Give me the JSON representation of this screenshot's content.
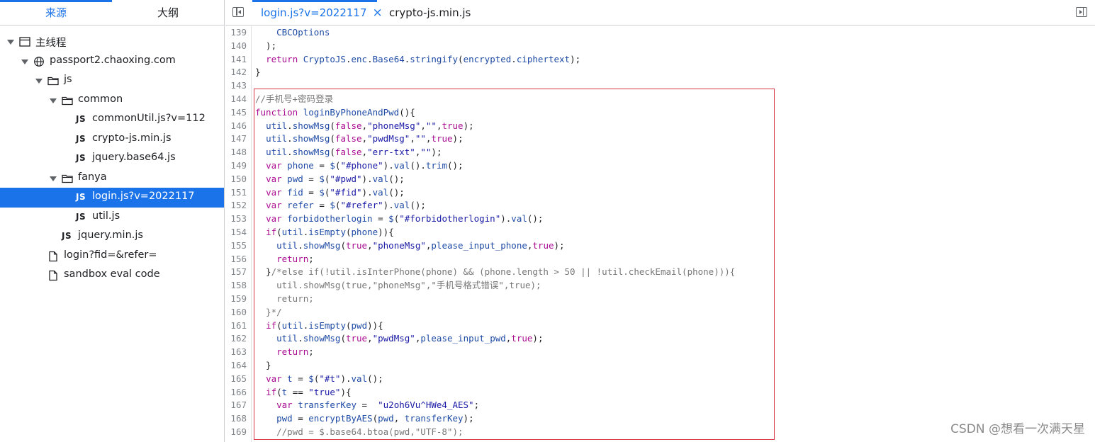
{
  "left_tabs": [
    {
      "label": "来源",
      "active": true
    },
    {
      "label": "大纲",
      "active": false
    }
  ],
  "tree": [
    {
      "label": "主线程",
      "depth": 0,
      "expanded": true,
      "icon": "window-icon"
    },
    {
      "label": "passport2.chaoxing.com",
      "depth": 1,
      "expanded": true,
      "icon": "globe-icon"
    },
    {
      "label": "js",
      "depth": 2,
      "expanded": true,
      "icon": "folder-icon"
    },
    {
      "label": "common",
      "depth": 3,
      "expanded": true,
      "icon": "folder-icon"
    },
    {
      "label": "commonUtil.js?v=112",
      "depth": 4,
      "icon": "js-file-icon"
    },
    {
      "label": "crypto-js.min.js",
      "depth": 4,
      "icon": "js-file-icon"
    },
    {
      "label": "jquery.base64.js",
      "depth": 4,
      "icon": "js-file-icon"
    },
    {
      "label": "fanya",
      "depth": 3,
      "expanded": true,
      "icon": "folder-icon"
    },
    {
      "label": "login.js?v=2022117",
      "depth": 4,
      "icon": "js-file-icon",
      "selected": true
    },
    {
      "label": "util.js",
      "depth": 4,
      "icon": "js-file-icon"
    },
    {
      "label": "jquery.min.js",
      "depth": 3,
      "icon": "js-file-icon"
    },
    {
      "label": "login?fid=&refer=",
      "depth": 2,
      "icon": "document-icon"
    },
    {
      "label": "sandbox eval code",
      "depth": 2,
      "icon": "document-icon"
    }
  ],
  "editor_tabs": [
    {
      "label": "login.js?v=2022117",
      "active": true,
      "closable": true
    },
    {
      "label": "crypto-js.min.js",
      "active": false
    }
  ],
  "icons": {
    "close": "×",
    "js": "JS"
  },
  "code_lines": [
    {
      "n": 139,
      "tokens": [
        [
          "d",
          "    "
        ],
        [
          "v",
          "CBCOptions"
        ]
      ]
    },
    {
      "n": 140,
      "tokens": [
        [
          "d",
          "  );"
        ]
      ]
    },
    {
      "n": 141,
      "tokens": [
        [
          "d",
          "  "
        ],
        [
          "k",
          "return"
        ],
        [
          "d",
          " "
        ],
        [
          "v",
          "CryptoJS"
        ],
        [
          "d",
          "."
        ],
        [
          "v",
          "enc"
        ],
        [
          "d",
          "."
        ],
        [
          "v",
          "Base64"
        ],
        [
          "d",
          "."
        ],
        [
          "v",
          "stringify"
        ],
        [
          "d",
          "("
        ],
        [
          "v",
          "encrypted"
        ],
        [
          "d",
          "."
        ],
        [
          "v",
          "ciphertext"
        ],
        [
          "d",
          ");"
        ]
      ]
    },
    {
      "n": 142,
      "tokens": [
        [
          "d",
          "}"
        ]
      ]
    },
    {
      "n": 143,
      "tokens": [
        [
          "d",
          ""
        ]
      ]
    },
    {
      "n": 144,
      "tokens": [
        [
          "c",
          "//手机号+密码登录"
        ]
      ]
    },
    {
      "n": 145,
      "tokens": [
        [
          "k",
          "function"
        ],
        [
          "d",
          " "
        ],
        [
          "v",
          "loginByPhoneAndPwd"
        ],
        [
          "d",
          "(){"
        ]
      ]
    },
    {
      "n": 146,
      "tokens": [
        [
          "d",
          "  "
        ],
        [
          "v",
          "util"
        ],
        [
          "d",
          "."
        ],
        [
          "v",
          "showMsg"
        ],
        [
          "d",
          "("
        ],
        [
          "k",
          "false"
        ],
        [
          "d",
          ","
        ],
        [
          "s",
          "\"phoneMsg\""
        ],
        [
          "d",
          ","
        ],
        [
          "s",
          "\"\""
        ],
        [
          "d",
          ","
        ],
        [
          "k",
          "true"
        ],
        [
          "d",
          ");"
        ]
      ]
    },
    {
      "n": 147,
      "tokens": [
        [
          "d",
          "  "
        ],
        [
          "v",
          "util"
        ],
        [
          "d",
          "."
        ],
        [
          "v",
          "showMsg"
        ],
        [
          "d",
          "("
        ],
        [
          "k",
          "false"
        ],
        [
          "d",
          ","
        ],
        [
          "s",
          "\"pwdMsg\""
        ],
        [
          "d",
          ","
        ],
        [
          "s",
          "\"\""
        ],
        [
          "d",
          ","
        ],
        [
          "k",
          "true"
        ],
        [
          "d",
          ");"
        ]
      ]
    },
    {
      "n": 148,
      "tokens": [
        [
          "d",
          "  "
        ],
        [
          "v",
          "util"
        ],
        [
          "d",
          "."
        ],
        [
          "v",
          "showMsg"
        ],
        [
          "d",
          "("
        ],
        [
          "k",
          "false"
        ],
        [
          "d",
          ","
        ],
        [
          "s",
          "\"err-txt\""
        ],
        [
          "d",
          ","
        ],
        [
          "s",
          "\"\""
        ],
        [
          "d",
          ");"
        ]
      ]
    },
    {
      "n": 149,
      "tokens": [
        [
          "d",
          "  "
        ],
        [
          "k",
          "var"
        ],
        [
          "d",
          " "
        ],
        [
          "v",
          "phone"
        ],
        [
          "d",
          " = "
        ],
        [
          "v",
          "$"
        ],
        [
          "d",
          "("
        ],
        [
          "s",
          "\"#phone\""
        ],
        [
          "d",
          ")."
        ],
        [
          "v",
          "val"
        ],
        [
          "d",
          "()."
        ],
        [
          "v",
          "trim"
        ],
        [
          "d",
          "();"
        ]
      ]
    },
    {
      "n": 150,
      "tokens": [
        [
          "d",
          "  "
        ],
        [
          "k",
          "var"
        ],
        [
          "d",
          " "
        ],
        [
          "v",
          "pwd"
        ],
        [
          "d",
          " = "
        ],
        [
          "v",
          "$"
        ],
        [
          "d",
          "("
        ],
        [
          "s",
          "\"#pwd\""
        ],
        [
          "d",
          ")."
        ],
        [
          "v",
          "val"
        ],
        [
          "d",
          "();"
        ]
      ]
    },
    {
      "n": 151,
      "tokens": [
        [
          "d",
          "  "
        ],
        [
          "k",
          "var"
        ],
        [
          "d",
          " "
        ],
        [
          "v",
          "fid"
        ],
        [
          "d",
          " = "
        ],
        [
          "v",
          "$"
        ],
        [
          "d",
          "("
        ],
        [
          "s",
          "\"#fid\""
        ],
        [
          "d",
          ")."
        ],
        [
          "v",
          "val"
        ],
        [
          "d",
          "();"
        ]
      ]
    },
    {
      "n": 152,
      "tokens": [
        [
          "d",
          "  "
        ],
        [
          "k",
          "var"
        ],
        [
          "d",
          " "
        ],
        [
          "v",
          "refer"
        ],
        [
          "d",
          " = "
        ],
        [
          "v",
          "$"
        ],
        [
          "d",
          "("
        ],
        [
          "s",
          "\"#refer\""
        ],
        [
          "d",
          ")."
        ],
        [
          "v",
          "val"
        ],
        [
          "d",
          "();"
        ]
      ]
    },
    {
      "n": 153,
      "tokens": [
        [
          "d",
          "  "
        ],
        [
          "k",
          "var"
        ],
        [
          "d",
          " "
        ],
        [
          "v",
          "forbidotherlogin"
        ],
        [
          "d",
          " = "
        ],
        [
          "v",
          "$"
        ],
        [
          "d",
          "("
        ],
        [
          "s",
          "\"#forbidotherlogin\""
        ],
        [
          "d",
          ")."
        ],
        [
          "v",
          "val"
        ],
        [
          "d",
          "();"
        ]
      ]
    },
    {
      "n": 154,
      "tokens": [
        [
          "d",
          "  "
        ],
        [
          "k",
          "if"
        ],
        [
          "d",
          "("
        ],
        [
          "v",
          "util"
        ],
        [
          "d",
          "."
        ],
        [
          "v",
          "isEmpty"
        ],
        [
          "d",
          "("
        ],
        [
          "v",
          "phone"
        ],
        [
          "d",
          ")){"
        ]
      ]
    },
    {
      "n": 155,
      "tokens": [
        [
          "d",
          "    "
        ],
        [
          "v",
          "util"
        ],
        [
          "d",
          "."
        ],
        [
          "v",
          "showMsg"
        ],
        [
          "d",
          "("
        ],
        [
          "k",
          "true"
        ],
        [
          "d",
          ","
        ],
        [
          "s",
          "\"phoneMsg\""
        ],
        [
          "d",
          ","
        ],
        [
          "v",
          "please_input_phone"
        ],
        [
          "d",
          ","
        ],
        [
          "k",
          "true"
        ],
        [
          "d",
          ");"
        ]
      ]
    },
    {
      "n": 156,
      "tokens": [
        [
          "d",
          "    "
        ],
        [
          "k",
          "return"
        ],
        [
          "d",
          ";"
        ]
      ]
    },
    {
      "n": 157,
      "tokens": [
        [
          "d",
          "  }"
        ],
        [
          "c",
          "/*else if(!util.isInterPhone(phone) && (phone.length > 50 || !util.checkEmail(phone))){"
        ]
      ]
    },
    {
      "n": 158,
      "tokens": [
        [
          "c",
          "    util.showMsg(true,\"phoneMsg\",\"手机号格式错误\",true);"
        ]
      ]
    },
    {
      "n": 159,
      "tokens": [
        [
          "c",
          "    return;"
        ]
      ]
    },
    {
      "n": 160,
      "tokens": [
        [
          "c",
          "  }*/"
        ]
      ]
    },
    {
      "n": 161,
      "tokens": [
        [
          "d",
          "  "
        ],
        [
          "k",
          "if"
        ],
        [
          "d",
          "("
        ],
        [
          "v",
          "util"
        ],
        [
          "d",
          "."
        ],
        [
          "v",
          "isEmpty"
        ],
        [
          "d",
          "("
        ],
        [
          "v",
          "pwd"
        ],
        [
          "d",
          ")){"
        ]
      ]
    },
    {
      "n": 162,
      "tokens": [
        [
          "d",
          "    "
        ],
        [
          "v",
          "util"
        ],
        [
          "d",
          "."
        ],
        [
          "v",
          "showMsg"
        ],
        [
          "d",
          "("
        ],
        [
          "k",
          "true"
        ],
        [
          "d",
          ","
        ],
        [
          "s",
          "\"pwdMsg\""
        ],
        [
          "d",
          ","
        ],
        [
          "v",
          "please_input_pwd"
        ],
        [
          "d",
          ","
        ],
        [
          "k",
          "true"
        ],
        [
          "d",
          ");"
        ]
      ]
    },
    {
      "n": 163,
      "tokens": [
        [
          "d",
          "    "
        ],
        [
          "k",
          "return"
        ],
        [
          "d",
          ";"
        ]
      ]
    },
    {
      "n": 164,
      "tokens": [
        [
          "d",
          "  }"
        ]
      ]
    },
    {
      "n": 165,
      "tokens": [
        [
          "d",
          "  "
        ],
        [
          "k",
          "var"
        ],
        [
          "d",
          " "
        ],
        [
          "v",
          "t"
        ],
        [
          "d",
          " = "
        ],
        [
          "v",
          "$"
        ],
        [
          "d",
          "("
        ],
        [
          "s",
          "\"#t\""
        ],
        [
          "d",
          ")."
        ],
        [
          "v",
          "val"
        ],
        [
          "d",
          "();"
        ]
      ]
    },
    {
      "n": 166,
      "tokens": [
        [
          "d",
          "  "
        ],
        [
          "k",
          "if"
        ],
        [
          "d",
          "("
        ],
        [
          "v",
          "t"
        ],
        [
          "d",
          " == "
        ],
        [
          "s",
          "\"true\""
        ],
        [
          "d",
          "){"
        ]
      ]
    },
    {
      "n": 167,
      "tokens": [
        [
          "d",
          "    "
        ],
        [
          "k",
          "var"
        ],
        [
          "d",
          " "
        ],
        [
          "v",
          "transferKey"
        ],
        [
          "d",
          " =  "
        ],
        [
          "s",
          "\"u2oh6Vu^HWe4_AES\""
        ],
        [
          "d",
          ";"
        ]
      ]
    },
    {
      "n": 168,
      "tokens": [
        [
          "d",
          "    "
        ],
        [
          "v",
          "pwd"
        ],
        [
          "d",
          " = "
        ],
        [
          "v",
          "encryptByAES"
        ],
        [
          "d",
          "("
        ],
        [
          "v",
          "pwd"
        ],
        [
          "d",
          ", "
        ],
        [
          "v",
          "transferKey"
        ],
        [
          "d",
          ");"
        ]
      ]
    },
    {
      "n": 169,
      "tokens": [
        [
          "c",
          "    //pwd = $.base64.btoa(pwd,\"UTF-8\");"
        ]
      ]
    }
  ],
  "watermark": "CSDN @想看一次满天星",
  "colors": {
    "accent": "#1a73e8",
    "highlight_border": "#d93746",
    "keyword": "#aa0d91",
    "string": "#1a1aa6",
    "comment": "#777777"
  }
}
